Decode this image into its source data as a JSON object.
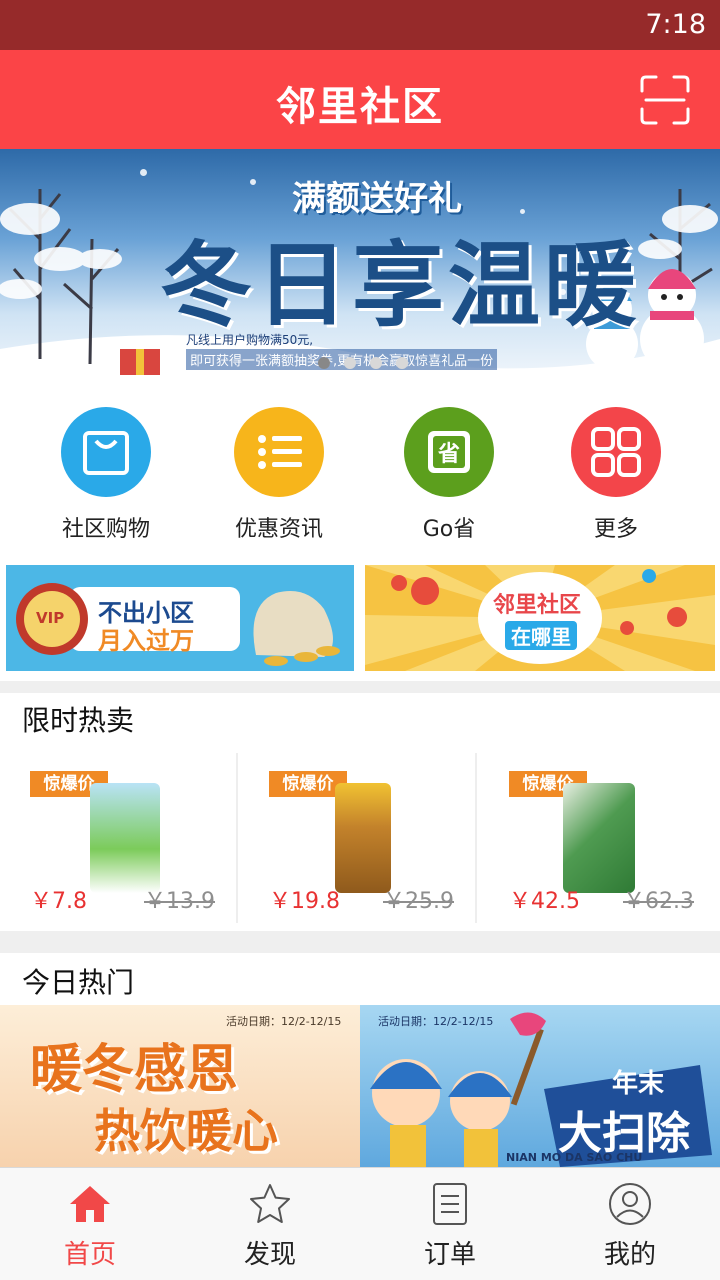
{
  "status_bar": {
    "time": "7:18"
  },
  "app_bar": {
    "title": "邻里社区"
  },
  "banner": {
    "subtitle": "满额送好礼",
    "headline": "冬日享温暖",
    "note_line1": "凡线上用户购物满50元,",
    "note_line2": "即可获得一张满额抽奖券,更有机会赢取惊喜礼品一份",
    "active_dot": 0,
    "dot_count": 4
  },
  "quick_menu": [
    {
      "label": "社区购物",
      "icon": "shopping-bag-icon",
      "color": "#2aa9e8"
    },
    {
      "label": "优惠资讯",
      "icon": "list-icon",
      "color": "#f7b51b"
    },
    {
      "label": "Go省",
      "icon": "save-tag-icon",
      "color": "#5c9f1d"
    },
    {
      "label": "更多",
      "icon": "grid-icon",
      "color": "#f3454a"
    }
  ],
  "promos": {
    "left": {
      "badge": "VIP",
      "line1": "不出小区",
      "line2": "月入过万"
    },
    "right": {
      "line1": "邻里社区",
      "line2": "在哪里"
    }
  },
  "flash_sale": {
    "title": "限时热卖",
    "tag": "惊爆价",
    "items": [
      {
        "price": "￥7.8",
        "old_price": "￥13.9",
        "img_color": "#7ccb5a"
      },
      {
        "price": "￥19.8",
        "old_price": "￥25.9",
        "img_color": "#c3822b"
      },
      {
        "price": "￥42.5",
        "old_price": "￥62.3",
        "img_color": "#4f9b51"
      }
    ]
  },
  "today_hot": {
    "title": "今日热门",
    "left": {
      "date": "活动日期：12/2-12/15",
      "line1": "暖冬感恩",
      "line2": "热饮暖心"
    },
    "right": {
      "date": "活动日期：12/2-12/15",
      "line1": "年末",
      "line2": "大扫除",
      "line3": "NIAN MO DA SAO CHU"
    }
  },
  "tabs": [
    {
      "label": "首页",
      "icon": "home-icon",
      "active": true
    },
    {
      "label": "发现",
      "icon": "star-icon",
      "active": false
    },
    {
      "label": "订单",
      "icon": "order-list-icon",
      "active": false
    },
    {
      "label": "我的",
      "icon": "profile-icon",
      "active": false
    }
  ]
}
